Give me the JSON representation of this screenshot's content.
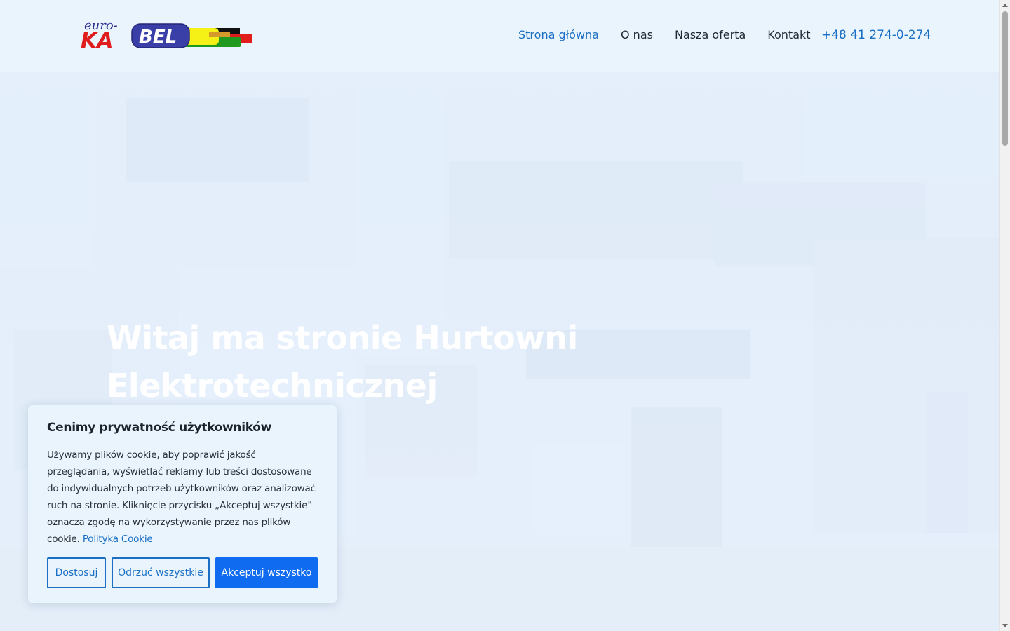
{
  "logo": {
    "top_text": "euro-",
    "ka_text": "KA",
    "bel_text": "BEL"
  },
  "nav": {
    "items": [
      {
        "label": "Strona główna",
        "active": true
      },
      {
        "label": "O nas",
        "active": false
      },
      {
        "label": "Nasza oferta",
        "active": false
      },
      {
        "label": "Kontakt",
        "active": false
      }
    ],
    "phone": "+48 41 274-0-274"
  },
  "hero": {
    "line1": "Witaj ma stronie Hurtowni",
    "line2": "Elektrotechnicznej"
  },
  "cookie": {
    "title": "Cenimy prywatność użytkowników",
    "body": "Używamy plików cookie, aby poprawić jakość przeglądania, wyświetlać reklamy lub treści dostosowane do indywidualnych potrzeb użytkowników oraz analizować ruch na stronie. Kliknięcie przycisku „Akceptuj wszystkie” oznacza zgodę na wykorzystywanie przez nas plików cookie.",
    "policy_link": "Polityka Cookie",
    "buttons": {
      "customize": "Dostosuj",
      "reject": "Odrzuć wszystkie",
      "accept": "Akceptuj wszystko"
    }
  },
  "colors": {
    "accent": "#1a6fc4",
    "primary_button": "#0f6bf0",
    "header_bg": "#e9f4fd"
  }
}
